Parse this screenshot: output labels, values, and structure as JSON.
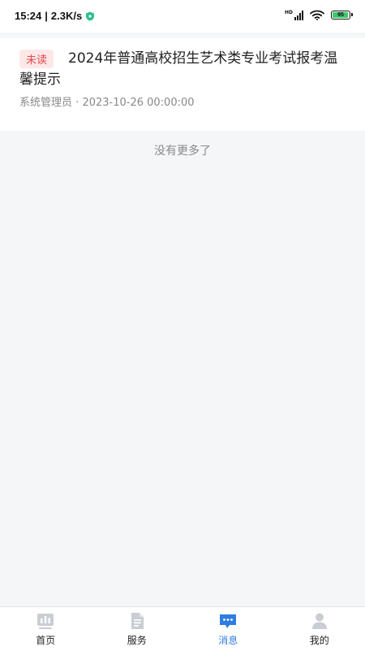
{
  "status_bar": {
    "time": "15:24",
    "net_speed": "2.3K/s",
    "battery_level": "95"
  },
  "messages": [
    {
      "tag": "未读",
      "title": "2024年普通高校招生艺术类专业考试报考温馨提示",
      "sender": "系统管理员",
      "separator": "·",
      "datetime": "2023-10-26 00:00:00"
    }
  ],
  "no_more_text": "没有更多了",
  "tabs": [
    {
      "label": "首页",
      "icon": "home-chart-icon",
      "active": false
    },
    {
      "label": "服务",
      "icon": "document-icon",
      "active": false
    },
    {
      "label": "消息",
      "icon": "chat-bubble-icon",
      "active": true
    },
    {
      "label": "我的",
      "icon": "person-icon",
      "active": false
    }
  ],
  "colors": {
    "accent": "#2f7de1",
    "unread_bg": "#fde8e8",
    "unread_text": "#e5484d",
    "inactive_icon": "#c9cdd4"
  }
}
